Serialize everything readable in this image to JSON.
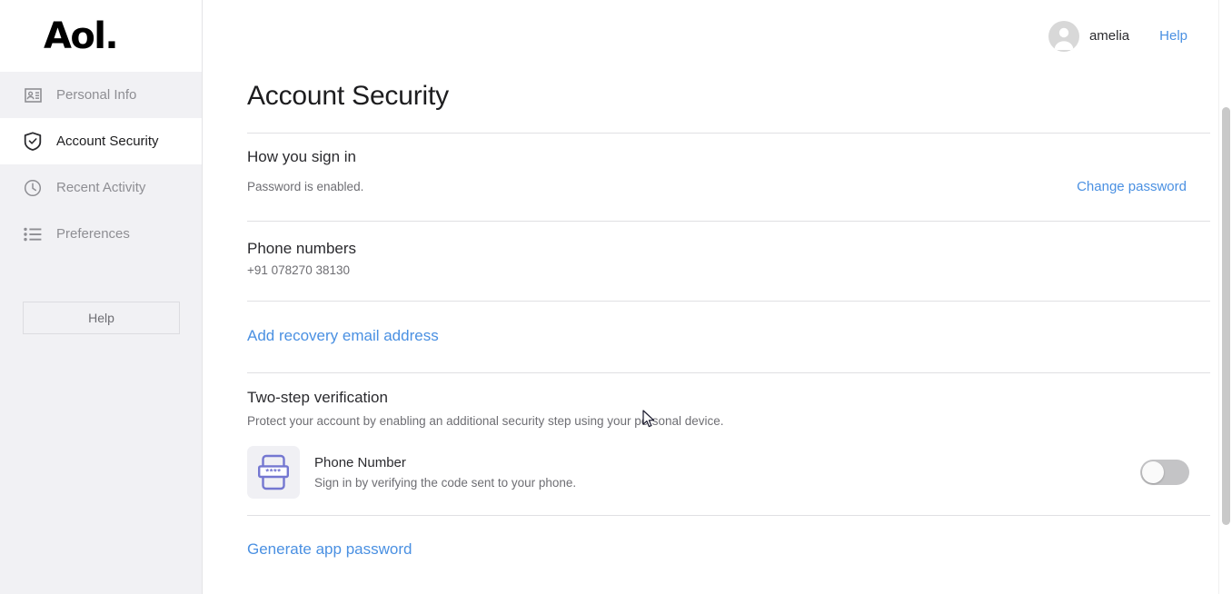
{
  "brand": {
    "logo_text": "Aol."
  },
  "header": {
    "user_name": "amelia",
    "help_label": "Help",
    "avatar_icon": "person-avatar-icon"
  },
  "sidebar": {
    "items": [
      {
        "label": "Personal Info",
        "icon": "contact-card-icon",
        "active": false
      },
      {
        "label": "Account Security",
        "icon": "shield-check-icon",
        "active": true
      },
      {
        "label": "Recent Activity",
        "icon": "clock-icon",
        "active": false
      },
      {
        "label": "Preferences",
        "icon": "list-bullet-icon",
        "active": false
      }
    ],
    "help_button_label": "Help"
  },
  "main": {
    "page_title": "Account Security",
    "sections": {
      "sign_in": {
        "title": "How you sign in",
        "status": "Password is enabled.",
        "action_label": "Change password"
      },
      "phone_numbers": {
        "title": "Phone numbers",
        "value": "+91 078270 38130"
      },
      "recovery_email": {
        "action_label": "Add recovery email address"
      },
      "two_step": {
        "title": "Two-step verification",
        "description": "Protect your account by enabling an additional security step using your personal device.",
        "method": {
          "name": "Phone Number",
          "description": "Sign in by verifying the code sent to your phone.",
          "icon": "phone-code-icon",
          "enabled": false
        }
      },
      "app_password": {
        "action_label": "Generate app password"
      }
    }
  },
  "colors": {
    "link_blue": "#4a90e2",
    "sidebar_bg": "#f1f1f4",
    "icon_purple": "#7477d1",
    "toggle_off": "#c4c4c6"
  }
}
